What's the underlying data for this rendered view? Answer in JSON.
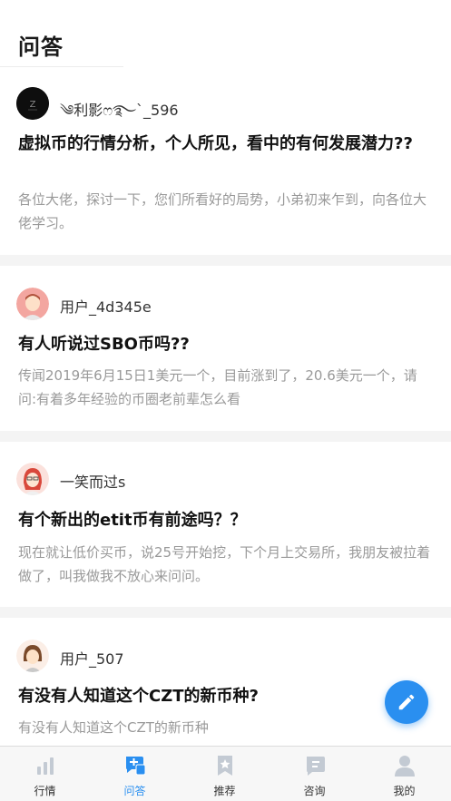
{
  "page_title": "问答",
  "questions": [
    {
      "username": "༄利影ෆ࿐`_596",
      "title": "虚拟币的行情分析，个人所见，看中的有何发展潜力??",
      "description": "各位大佬，探讨一下，您们所看好的局势，小弟初来乍到，向各位大佬学习。"
    },
    {
      "username": "用户_4d345e",
      "title": "有人听说过SBO币吗??",
      "description": "传闻2019年6月15日1美元一个，目前涨到了，20.6美元一个，请问:有着多年经验的币圈老前辈怎么看"
    },
    {
      "username": "一笑而过s",
      "title": "有个新出的etit币有前途吗？？",
      "description": "现在就让低价买币，说25号开始挖，下个月上交易所，我朋友被拉着做了，叫我做我不放心来问问。"
    },
    {
      "username": "用户_507",
      "title": "有没有人知道这个CZT的新币种?",
      "description": "有没有人知道这个CZT的新币种"
    }
  ],
  "tabs": [
    {
      "label": "行情",
      "icon": "bar-chart-icon"
    },
    {
      "label": "问答",
      "icon": "chat-plus-icon"
    },
    {
      "label": "推荐",
      "icon": "bookmark-star-icon"
    },
    {
      "label": "咨询",
      "icon": "message-icon"
    },
    {
      "label": "我的",
      "icon": "user-icon"
    }
  ],
  "active_tab": "问答",
  "colors": {
    "accent": "#2a8ff0",
    "inactive_icon": "#c3cad3"
  },
  "fab_icon": "pencil-icon"
}
